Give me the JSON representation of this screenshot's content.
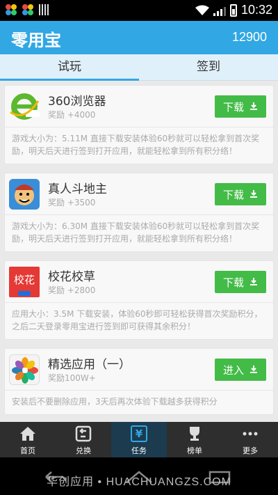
{
  "status_bar": {
    "time": "10:32"
  },
  "app_bar": {
    "title": "零用宝",
    "points": "12900"
  },
  "tabs": [
    {
      "label": "试玩",
      "active": true
    },
    {
      "label": "签到",
      "active": false
    }
  ],
  "cards": [
    {
      "name": "360浏览器",
      "reward": "奖励 +4000",
      "button": "下载",
      "description": "游戏大小为：5.11M 直接下载安装体验60秒就可以轻松拿到首次奖励，明天后天进行签到打开应用，就能轻松拿到所有积分络！",
      "icon": "360-browser-icon"
    },
    {
      "name": "真人斗地主",
      "reward": "奖励 +3500",
      "button": "下载",
      "description": "游戏大小为：6.30M 直接下载安装体验60秒就可以轻松拿到首次奖励，明天后天进行签到打开应用，就能轻松拿到所有积分络！",
      "icon": "doudizhu-game-icon"
    },
    {
      "name": "校花校草",
      "reward": "奖励 +2800",
      "button": "下载",
      "description": "应用大小：3.5M 下载安装，体验60秒即可轻松获得首次奖励积分，之后二天登录零用宝进行签到即可获得其余积分！",
      "icon": "xiaohua-app-icon",
      "icon_text": "校花"
    },
    {
      "name": "精选应用（一）",
      "reward": "奖励100W+",
      "button": "进入",
      "description": "安装后不要删除应用，3天后再次体验下载越多获得积分",
      "icon": "flower-icon"
    }
  ],
  "nav": [
    {
      "label": "首页",
      "icon": "home-icon",
      "active": false
    },
    {
      "label": "兑换",
      "icon": "exchange-icon",
      "active": false
    },
    {
      "label": "任务",
      "icon": "task-icon",
      "active": true,
      "icon_text": "¥"
    },
    {
      "label": "榜单",
      "icon": "trophy-icon",
      "active": false
    },
    {
      "label": "更多",
      "icon": "more-icon",
      "active": false
    }
  ],
  "watermark": "华创应用 • HUACHUANGZS.COM",
  "colors": {
    "accent": "#31a7e4",
    "button": "#43bb47",
    "nav_bg": "#2e2e2e"
  }
}
